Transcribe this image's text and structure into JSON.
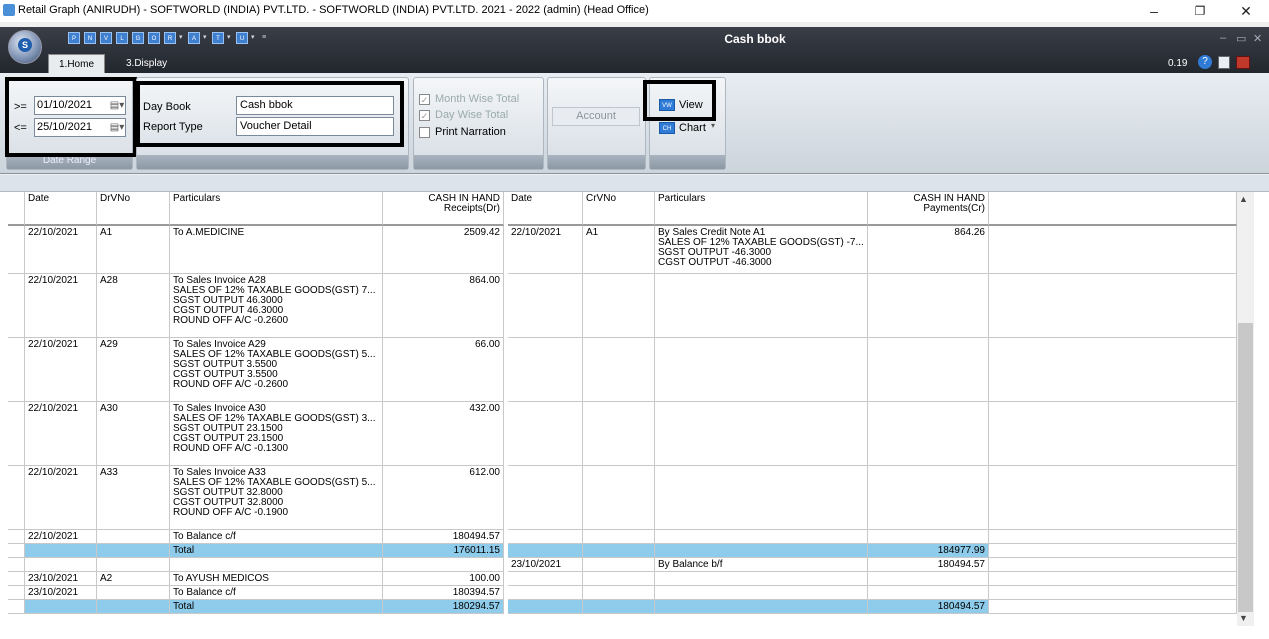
{
  "window": {
    "title": "Retail Graph (ANIRUDH) - SOFTWORLD (INDIA) PVT.LTD. - SOFTWORLD (INDIA) PVT.LTD.  2021 - 2022 (admin) (Head Office)",
    "min": "–",
    "max": "❐",
    "close": "✕"
  },
  "ribbon": {
    "doc_title": "Cash bbok",
    "version": "0.19",
    "tabs": [
      "1.Home",
      "3.Display"
    ],
    "date_range": {
      "from_op": ">=",
      "from": "01/10/2021",
      "to_op": "<=",
      "to": "25/10/2021",
      "label": "Date Range"
    },
    "day_book_label": "Day Book",
    "day_book_value": "Cash bbok",
    "report_type_label": "Report Type",
    "report_type_value": "Voucher Detail",
    "month_wise": "Month Wise Total",
    "day_wise": "Day Wise Total",
    "print_narration": "Print Narration",
    "account": "Account",
    "view": "View",
    "chart": "Chart"
  },
  "grid": {
    "headers": {
      "date": "Date",
      "drvno": "DrVNo",
      "particulars": "Particulars",
      "receipts": "CASH IN HAND\nReceipts(Dr)",
      "date2": "Date",
      "crvno": "CrVNo",
      "particulars2": "Particulars",
      "payments": "CASH IN HAND\nPayments(Cr)"
    },
    "rows": [
      [
        "22/10/2021",
        "A1",
        "To A.MEDICINE",
        "2509.42",
        "22/10/2021",
        "A1",
        "By Sales Credit Note A1\nSALES OF 12% TAXABLE GOODS(GST) -7...\nSGST OUTPUT -46.3000\nCGST OUTPUT -46.3000",
        "864.26"
      ],
      [
        "22/10/2021",
        "A28",
        "To Sales Invoice A28\nSALES OF 12% TAXABLE GOODS(GST) 7...\nSGST OUTPUT 46.3000\nCGST OUTPUT 46.3000\nROUND OFF A/C -0.2600",
        "864.00",
        "",
        "",
        "",
        ""
      ],
      [
        "22/10/2021",
        "A29",
        "To Sales Invoice A29\nSALES OF 12% TAXABLE GOODS(GST) 5...\nSGST OUTPUT 3.5500\nCGST OUTPUT 3.5500\nROUND OFF A/C -0.2600",
        "66.00",
        "",
        "",
        "",
        ""
      ],
      [
        "22/10/2021",
        "A30",
        "To Sales Invoice A30\nSALES OF 12% TAXABLE GOODS(GST) 3...\nSGST OUTPUT 23.1500\nCGST OUTPUT 23.1500\nROUND OFF A/C -0.1300",
        "432.00",
        "",
        "",
        "",
        ""
      ],
      [
        "22/10/2021",
        "A33",
        "To Sales Invoice A33\nSALES OF 12% TAXABLE GOODS(GST) 5...\nSGST OUTPUT 32.8000\nCGST OUTPUT 32.8000\nROUND OFF A/C -0.1900",
        "612.00",
        "",
        "",
        "",
        ""
      ],
      [
        "22/10/2021",
        "",
        "To Balance c/f",
        "180494.57",
        "",
        "",
        "",
        ""
      ],
      [
        "",
        "",
        "Total",
        "176011.15",
        "",
        "",
        "",
        "184977.99"
      ],
      [
        "",
        "",
        "",
        "",
        "23/10/2021",
        "",
        "By Balance b/f",
        "180494.57"
      ],
      [
        "23/10/2021",
        "A2",
        "To AYUSH MEDICOS",
        "100.00",
        "",
        "",
        "",
        ""
      ],
      [
        "23/10/2021",
        "",
        "To Balance c/f",
        "180394.57",
        "",
        "",
        "",
        ""
      ],
      [
        "",
        "",
        "Total",
        "180294.57",
        "",
        "",
        "",
        "180494.57"
      ]
    ],
    "total_rows": [
      6,
      10
    ]
  }
}
